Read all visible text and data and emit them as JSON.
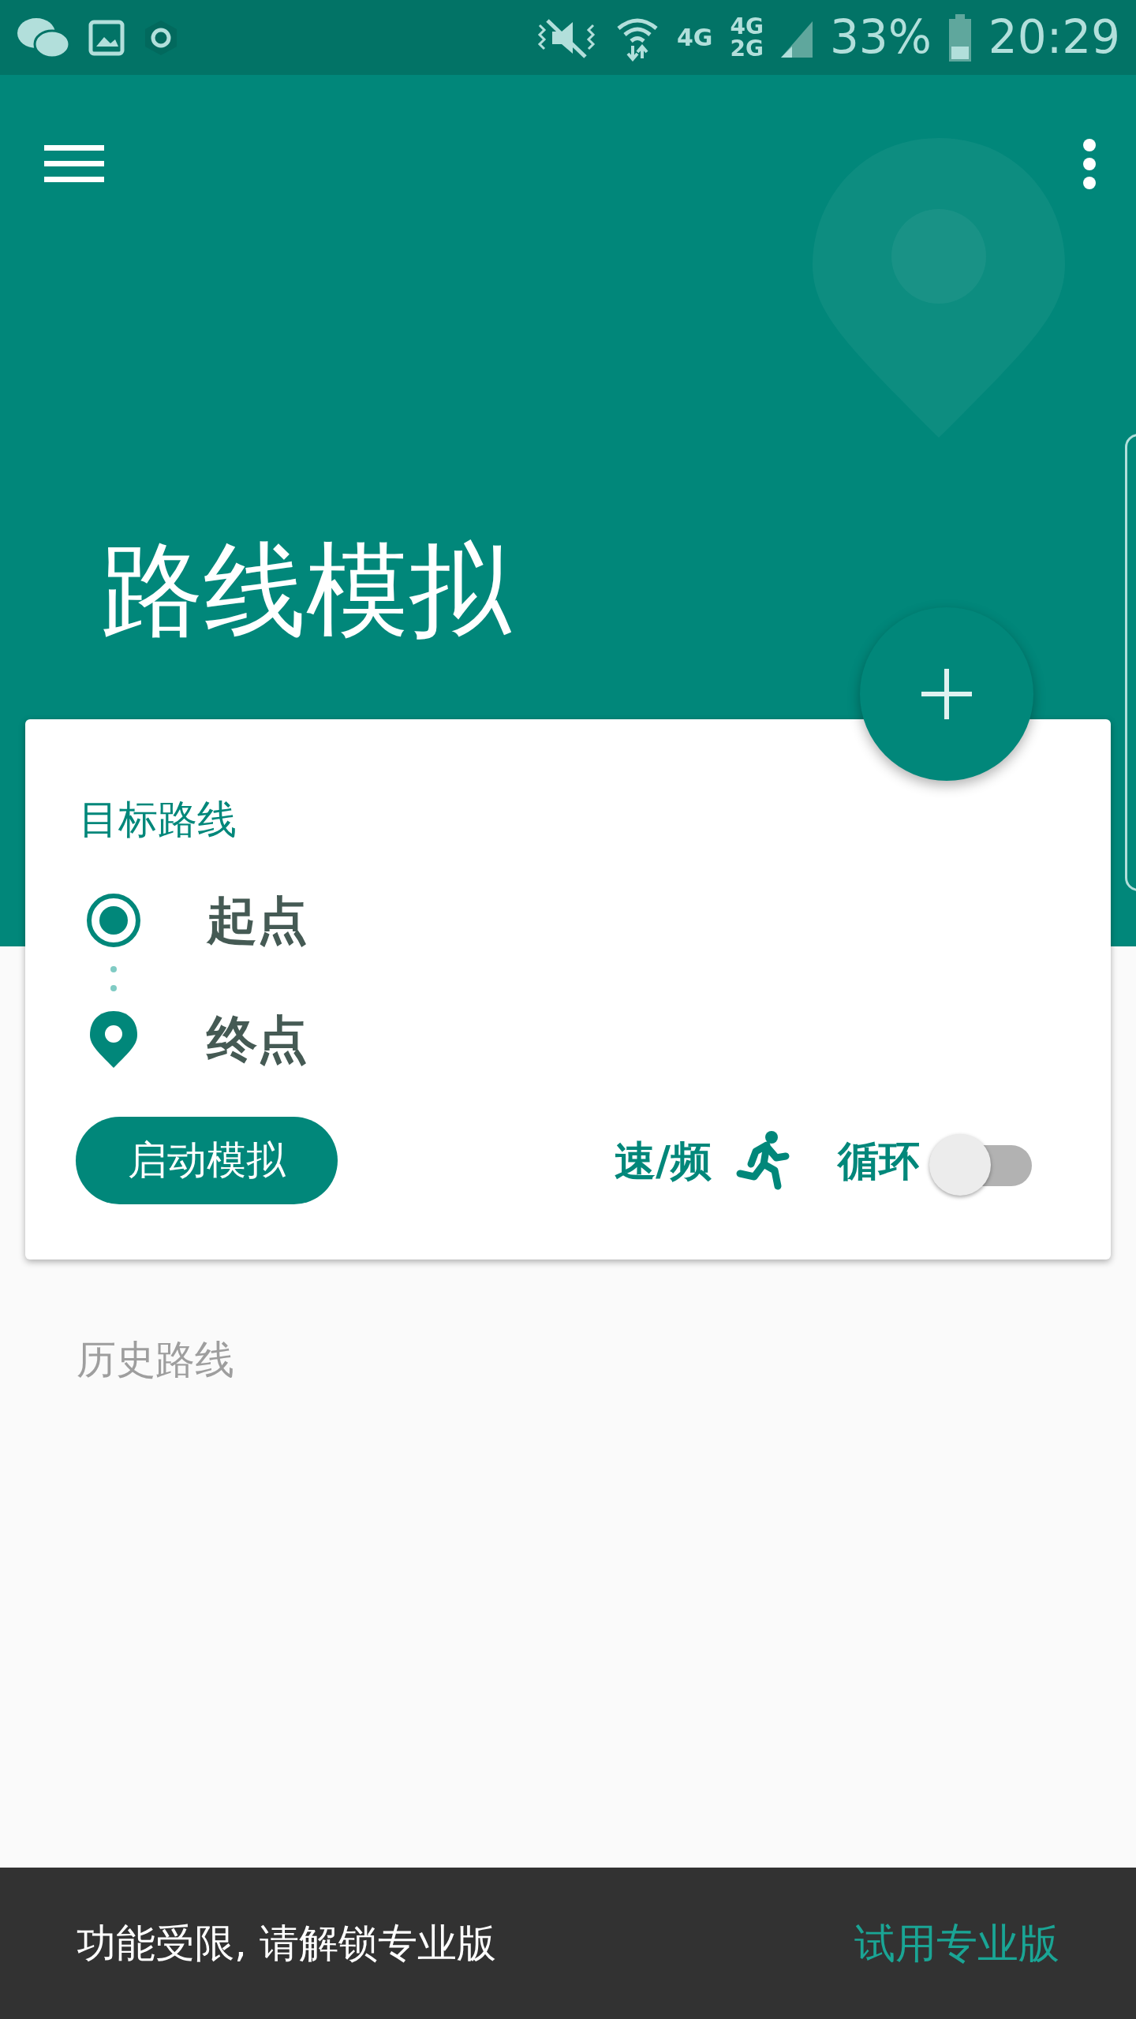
{
  "status_bar": {
    "network_1": "4G",
    "network_2_top": "4G",
    "network_2_bottom": "2G",
    "battery": "33%",
    "time": "20:29"
  },
  "header": {
    "title": "路线模拟"
  },
  "route_card": {
    "title": "目标路线",
    "points": [
      {
        "kind": "start",
        "label": "起点"
      },
      {
        "kind": "end",
        "label": "终点"
      }
    ],
    "start_button": "启动模拟",
    "speed_label": "速/频",
    "loop": {
      "label": "循环",
      "on": false
    }
  },
  "history": {
    "title": "历史路线"
  },
  "snackbar": {
    "message": "功能受限, 请解锁专业版",
    "action": "试用专业版"
  }
}
